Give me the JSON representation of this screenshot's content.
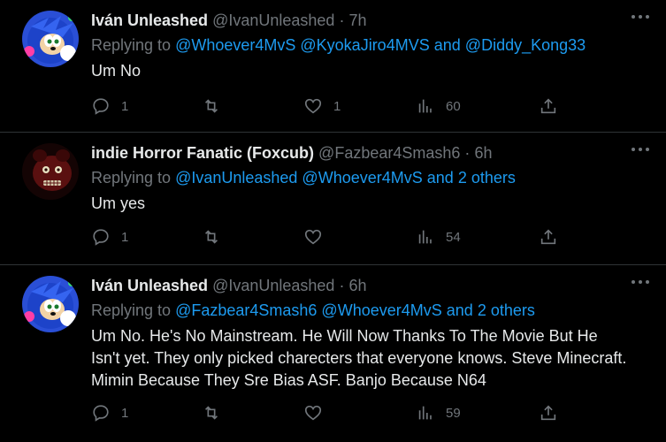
{
  "tweets": [
    {
      "name": "Iván Unleashed",
      "handle": "@IvanUnleashed",
      "dot": "·",
      "time": "7h",
      "replying_prefix": "Replying to",
      "replying_mentions": "@Whoever4MvS @KyokaJiro4MVS",
      "replying_and": "and",
      "replying_last": "@Diddy_Kong33",
      "text": "Um No",
      "replies": "1",
      "retweets": "",
      "likes": "1",
      "views": "60",
      "avatar_icon": "sonic-avatar"
    },
    {
      "name": "indie Horror Fanatic (Foxcub)",
      "handle": "@Fazbear4Smash6",
      "dot": "·",
      "time": "6h",
      "replying_prefix": "Replying to",
      "replying_mentions": "@IvanUnleashed @Whoever4MvS",
      "replying_and": "and",
      "replying_last": "2 others",
      "text": "Um yes",
      "replies": "1",
      "retweets": "",
      "likes": "",
      "views": "54",
      "avatar_icon": "red-animatronic-avatar"
    },
    {
      "name": "Iván Unleashed",
      "handle": "@IvanUnleashed",
      "dot": "·",
      "time": "6h",
      "replying_prefix": "Replying to",
      "replying_mentions": "@Fazbear4Smash6 @Whoever4MvS",
      "replying_and": "and",
      "replying_last": "2 others",
      "text": "Um No. He's No Mainstream. He Will Now Thanks To The Movie But He Isn't yet. They only picked charecters that everyone knows. Steve Minecraft. Mimin Because They Sre Bias ASF. Banjo Because N64",
      "replies": "1",
      "retweets": "",
      "likes": "",
      "views": "59",
      "avatar_icon": "sonic-avatar"
    }
  ],
  "colors": {
    "background": "#000000",
    "text": "#e7e9ea",
    "muted": "#71767b",
    "link": "#1d9bf0",
    "divider": "#2f3336"
  }
}
